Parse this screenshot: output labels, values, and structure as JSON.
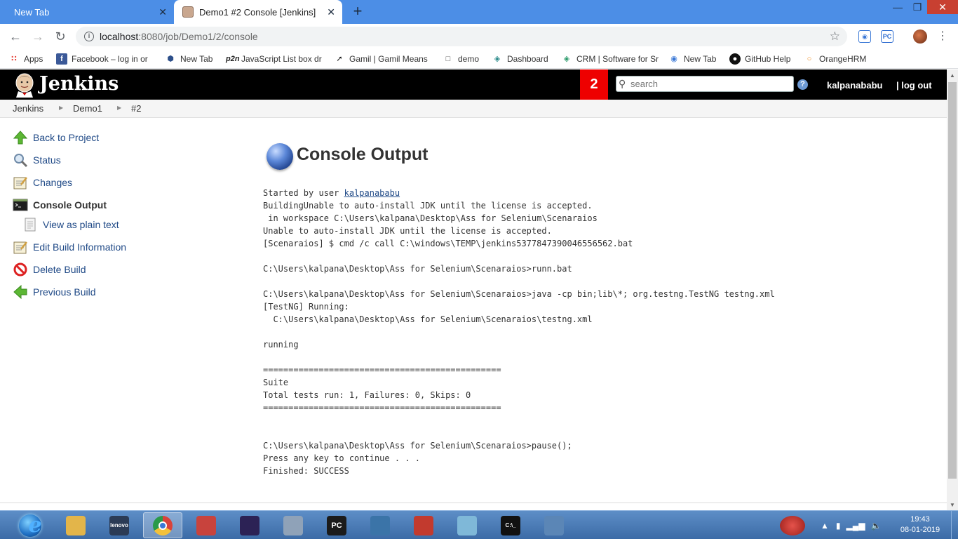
{
  "browser": {
    "tabs": [
      {
        "title": "New Tab",
        "close": "✕"
      },
      {
        "title": "Demo1 #2 Console [Jenkins]",
        "close": "✕"
      }
    ],
    "new_tab": "+",
    "window_controls": {
      "minimize": "—",
      "maximize": "❐",
      "close": "✕"
    },
    "url_host": "localhost",
    "url_rest": ":8080/job/Demo1/2/console",
    "extensions": [
      "ext-icon",
      "PC"
    ],
    "bookmarks": [
      {
        "label": "Apps",
        "icon": "apps-grid-icon"
      },
      {
        "label": "Facebook – log in or",
        "icon": "facebook-icon"
      },
      {
        "label": "New Tab",
        "icon": "shield-icon"
      },
      {
        "label": "JavaScript List box dr",
        "icon": "p2n-icon"
      },
      {
        "label": "Gamil | Gamil Means",
        "icon": "arrow-icon"
      },
      {
        "label": "demo",
        "icon": "page-icon"
      },
      {
        "label": "Dashboard",
        "icon": "dashboard-icon"
      },
      {
        "label": "CRM | Software for Sr",
        "icon": "crm-icon"
      },
      {
        "label": "New Tab",
        "icon": "newtab-icon"
      },
      {
        "label": "GitHub Help",
        "icon": "github-icon"
      },
      {
        "label": "OrangeHRM",
        "icon": "orange-icon"
      }
    ]
  },
  "jenkins": {
    "title": "Jenkins",
    "build_queue_count": "2",
    "search_placeholder": "search",
    "help": "?",
    "username": "kalpanababu",
    "logout": "| log out",
    "breadcrumbs": [
      "Jenkins",
      "Demo1",
      "#2"
    ],
    "breadcrumb_sep": "▶",
    "side_tasks": [
      {
        "label": "Back to Project",
        "icon": "up-arrow-icon"
      },
      {
        "label": "Status",
        "icon": "magnifier-icon"
      },
      {
        "label": "Changes",
        "icon": "notepad-icon"
      },
      {
        "label": "Console Output",
        "icon": "terminal-icon"
      },
      {
        "label": "View as plain text",
        "icon": "document-icon"
      },
      {
        "label": "Edit Build Information",
        "icon": "notepad-edit-icon"
      },
      {
        "label": "Delete Build",
        "icon": "no-entry-icon"
      },
      {
        "label": "Previous Build",
        "icon": "left-arrow-icon"
      }
    ],
    "page_title": "Console Output",
    "console": {
      "started_by_prefix": "Started by user ",
      "started_by_user": "kalpanababu",
      "body": "BuildingUnable to auto-install JDK until the license is accepted.\n in workspace C:\\Users\\kalpana\\Desktop\\Ass for Selenium\\Scenaraios\nUnable to auto-install JDK until the license is accepted.\n[Scenaraios] $ cmd /c call C:\\windows\\TEMP\\jenkins5377847390046556562.bat\n\nC:\\Users\\kalpana\\Desktop\\Ass for Selenium\\Scenaraios>runn.bat\n\nC:\\Users\\kalpana\\Desktop\\Ass for Selenium\\Scenaraios>java -cp bin;lib\\*; org.testng.TestNG testng.xml\n[TestNG] Running:\n  C:\\Users\\kalpana\\Desktop\\Ass for Selenium\\Scenaraios\\testng.xml\n\nrunning\n\n===============================================\nSuite\nTotal tests run: 1, Failures: 0, Skips: 0\n===============================================\n\n\nC:\\Users\\kalpana\\Desktop\\Ass for Selenium\\Scenaraios>pause();\nPress any key to continue . . .\nFinished: SUCCESS"
    }
  },
  "taskbar": {
    "apps": [
      {
        "name": "ie-icon",
        "glyph": "e",
        "color": "#2a7fd4"
      },
      {
        "name": "file-explorer-icon",
        "glyph": "",
        "color": "#e3b54a"
      },
      {
        "name": "lenovo-monitor-icon",
        "glyph": "lenovo",
        "color": "#2b3b55"
      },
      {
        "name": "chrome-icon",
        "glyph": "",
        "color": "#d9433a"
      },
      {
        "name": "notepad-plus-icon",
        "glyph": "",
        "color": "#c8433d"
      },
      {
        "name": "eclipse-icon",
        "glyph": "",
        "color": "#2c2255"
      },
      {
        "name": "settings-gear-icon",
        "glyph": "",
        "color": "#8fa2b8"
      },
      {
        "name": "pycharm-icon",
        "glyph": "PC",
        "color": "#1b1b1b"
      },
      {
        "name": "python-icon",
        "glyph": "",
        "color": "#3b74a8"
      },
      {
        "name": "winrar-icon",
        "glyph": "",
        "color": "#c23a2e"
      },
      {
        "name": "notepad-icon",
        "glyph": "",
        "color": "#7fb8d8"
      },
      {
        "name": "cmd-icon",
        "glyph": "C:\\_",
        "color": "#111111"
      },
      {
        "name": "control-panel-icon",
        "glyph": "",
        "color": "#5b86b6"
      }
    ],
    "clock_time": "19:43",
    "clock_date": "08-01-2019"
  }
}
